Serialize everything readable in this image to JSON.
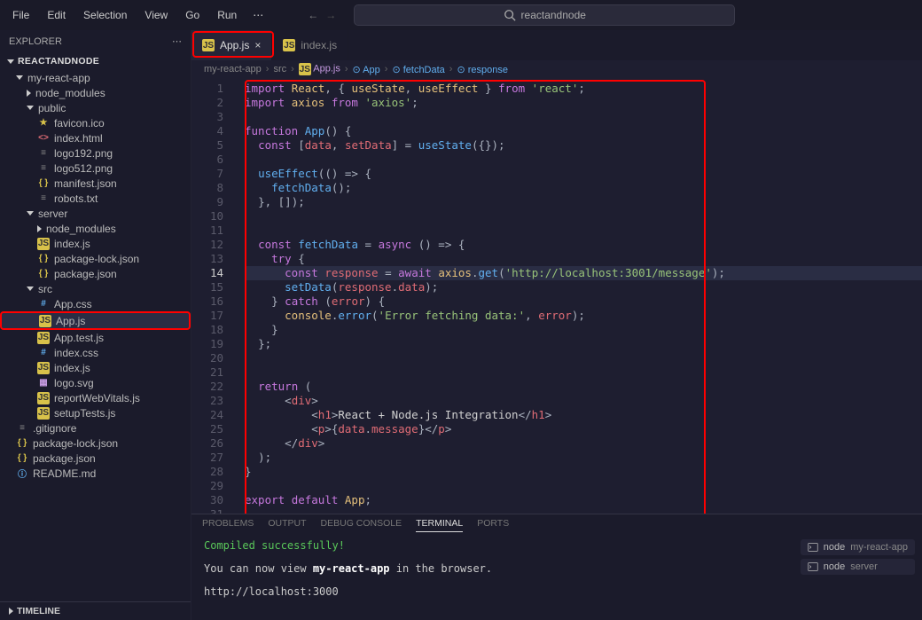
{
  "menu": [
    "File",
    "Edit",
    "Selection",
    "View",
    "Go",
    "Run"
  ],
  "search_text": "reactandnode",
  "explorer_label": "EXPLORER",
  "project_name": "REACTANDNODE",
  "tree": [
    {
      "d": 1,
      "t": "folder-open",
      "l": "my-react-app"
    },
    {
      "d": 2,
      "t": "folder",
      "l": "node_modules"
    },
    {
      "d": 2,
      "t": "folder-open",
      "l": "public"
    },
    {
      "d": 3,
      "t": "star",
      "l": "favicon.ico"
    },
    {
      "d": 3,
      "t": "html",
      "l": "index.html"
    },
    {
      "d": 3,
      "t": "file",
      "l": "logo192.png"
    },
    {
      "d": 3,
      "t": "file",
      "l": "logo512.png"
    },
    {
      "d": 3,
      "t": "json",
      "l": "manifest.json"
    },
    {
      "d": 3,
      "t": "file",
      "l": "robots.txt"
    },
    {
      "d": 2,
      "t": "folder-open",
      "l": "server"
    },
    {
      "d": 3,
      "t": "folder",
      "l": "node_modules"
    },
    {
      "d": 3,
      "t": "js",
      "l": "index.js"
    },
    {
      "d": 3,
      "t": "json",
      "l": "package-lock.json"
    },
    {
      "d": 3,
      "t": "json",
      "l": "package.json"
    },
    {
      "d": 2,
      "t": "folder-open",
      "l": "src"
    },
    {
      "d": 3,
      "t": "css",
      "l": "App.css"
    },
    {
      "d": 3,
      "t": "js",
      "l": "App.js",
      "sel": true,
      "hl": true
    },
    {
      "d": 3,
      "t": "js",
      "l": "App.test.js"
    },
    {
      "d": 3,
      "t": "css",
      "l": "index.css"
    },
    {
      "d": 3,
      "t": "js",
      "l": "index.js"
    },
    {
      "d": 3,
      "t": "svg",
      "l": "logo.svg"
    },
    {
      "d": 3,
      "t": "js",
      "l": "reportWebVitals.js"
    },
    {
      "d": 3,
      "t": "js",
      "l": "setupTests.js"
    },
    {
      "d": 1,
      "t": "file",
      "l": ".gitignore"
    },
    {
      "d": 1,
      "t": "json",
      "l": "package-lock.json"
    },
    {
      "d": 1,
      "t": "json",
      "l": "package.json"
    },
    {
      "d": 1,
      "t": "md",
      "l": "README.md"
    }
  ],
  "tabs": [
    {
      "icon": "js",
      "label": "App.js",
      "active": true,
      "close": true,
      "hl": true
    },
    {
      "icon": "js",
      "label": "index.js",
      "active": false
    }
  ],
  "breadcrumb": [
    {
      "t": "text",
      "v": "my-react-app"
    },
    {
      "t": "text",
      "v": "src"
    },
    {
      "t": "js",
      "v": "App.js"
    },
    {
      "t": "sym",
      "v": "App"
    },
    {
      "t": "sym",
      "v": "fetchData"
    },
    {
      "t": "sym",
      "v": "response"
    }
  ],
  "current_line": 14,
  "code_lines": 31,
  "term_tabs": [
    "PROBLEMS",
    "OUTPUT",
    "DEBUG CONSOLE",
    "TERMINAL",
    "PORTS"
  ],
  "term_active": "TERMINAL",
  "term_out": {
    "l1": "Compiled successfully!",
    "l2a": "You can now view ",
    "l2b": "my-react-app",
    "l2c": " in the browser.",
    "l3": "  http://localhost:3000"
  },
  "term_procs": [
    {
      "cmd": "node",
      "proj": "my-react-app"
    },
    {
      "cmd": "node",
      "proj": "server"
    }
  ],
  "timeline_label": "TIMELINE"
}
